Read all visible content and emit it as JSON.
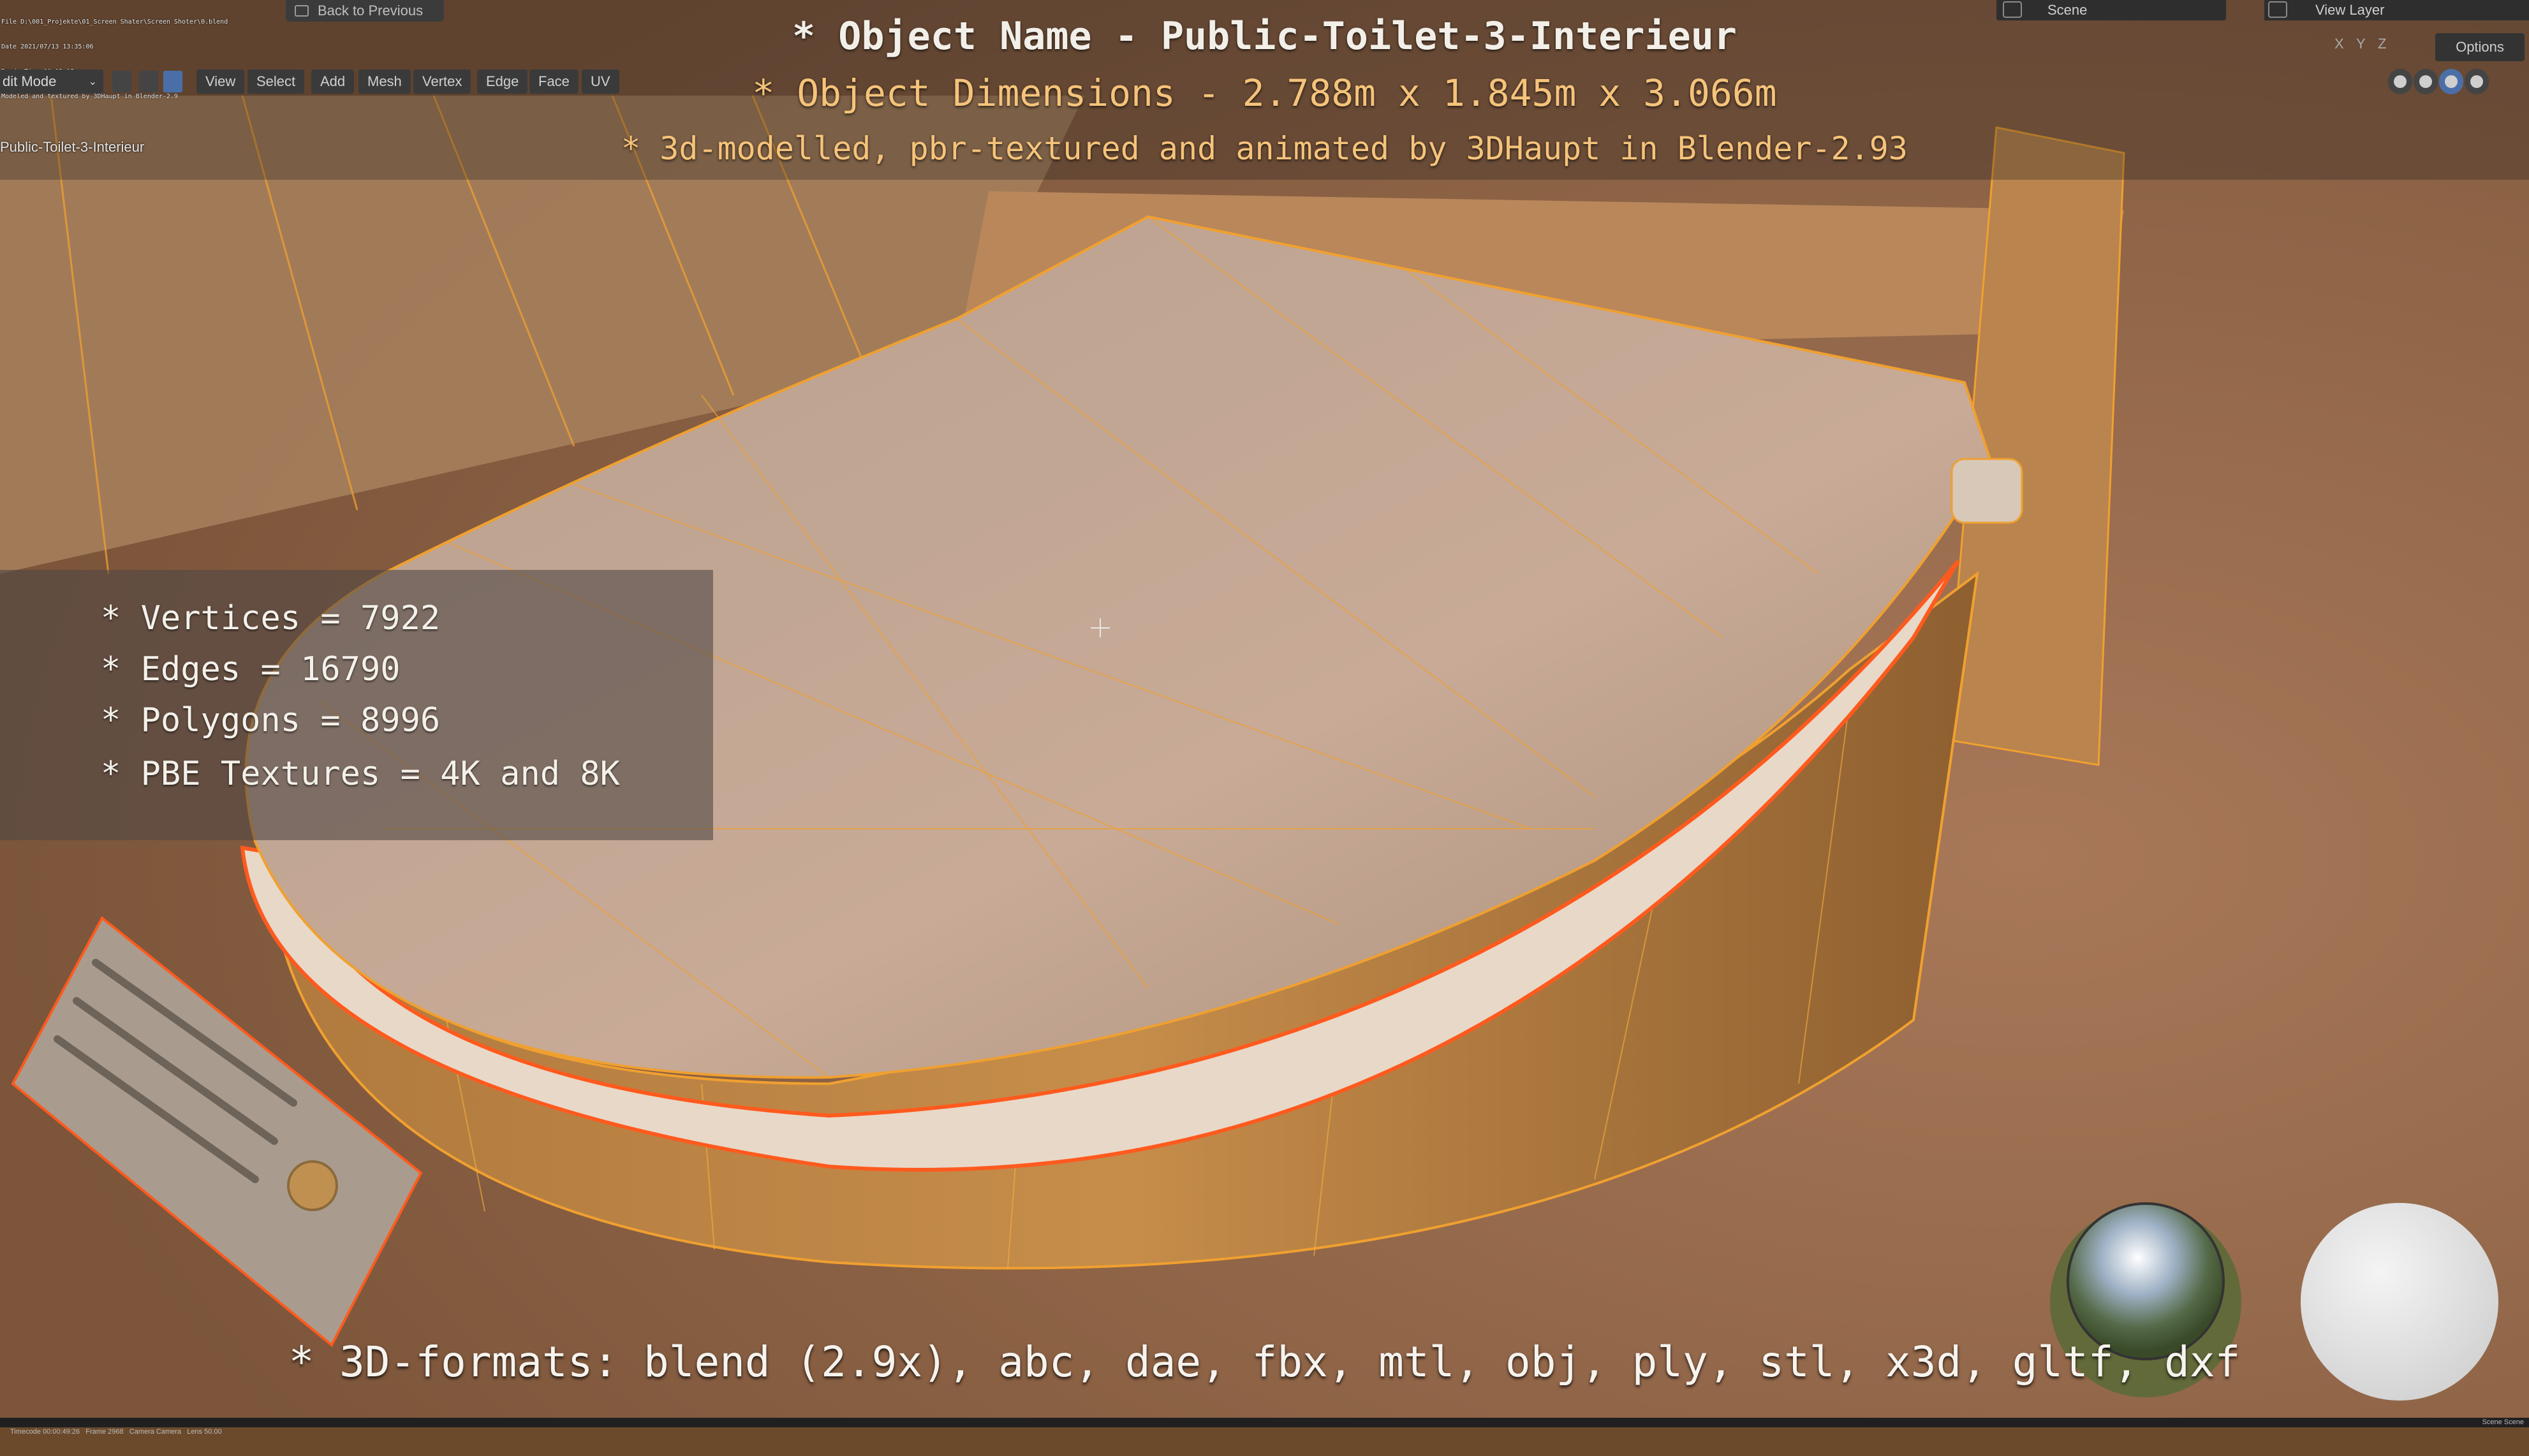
{
  "render_stamp": {
    "lines": [
      "File D:\\001_Projekte\\01_Screen Shater\\Screen Shoter\\0.blend",
      "Date 2021/07/13 13:35:06",
      "RenderTime 00:02.15",
      "Modeled and textured by 3DHaupt in Blender-2.9"
    ]
  },
  "header": {
    "back_button_label": "Back to Previous",
    "mode_select_value": "dit Mode",
    "menu": [
      "View",
      "Select",
      "Add",
      "Mesh",
      "Vertex",
      "Edge",
      "Face",
      "UV"
    ],
    "object_path": "Public-Toilet-3-Interieur",
    "scene_label": "Scene",
    "view_layer_label": "View Layer",
    "options_label": "Options",
    "axes": [
      "X",
      "Y",
      "Z"
    ]
  },
  "overlay": {
    "object_name": "* Object Name - Public-Toilet-3-Interieur",
    "object_dimensions": "* Object Dimensions -  2.788m x 1.845m x 3.066m",
    "credits": "* 3d-modelled, pbr-textured and animated by 3DHaupt in Blender-2.93",
    "stats": [
      "* Vertices = 7922",
      "* Edges = 16790",
      "* Polygons = 8996",
      "* PBE Textures = 4K and 8K"
    ],
    "formats": "* 3D-formats: blend (2.9x), abc, dae, fbx, mtl, obj, ply, stl, x3d, gltf, dxf"
  },
  "status_bar": {
    "left": "Timecode 00:00:49:26   Frame 2968   Camera Camera   Lens 50.00",
    "right": "Scene Scene"
  },
  "colors": {
    "selection_orange": "#f0a030",
    "active_edge": "#ff5a1e",
    "ui_active_blue": "#4a6fa8",
    "carpet": "#9a6a48"
  },
  "icons": [
    "cursor-crosshair-icon",
    "hdri-sphere-icon",
    "matcap-sphere-icon",
    "back-icon"
  ]
}
